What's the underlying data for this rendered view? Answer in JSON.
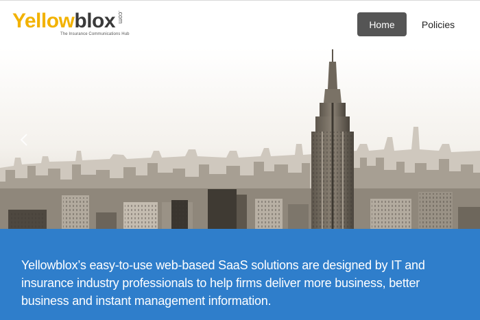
{
  "brand": {
    "logo_yellow": "Yellow",
    "logo_dark": "blox",
    "logo_com": ".com",
    "tagline": "The Insurance Communications Hub"
  },
  "nav": {
    "home_label": "Home",
    "policies_label": "Policies"
  },
  "hero": {
    "image": "city-skyline-photo",
    "prev_icon": "chevron-left-icon"
  },
  "banner": {
    "text": "Yellowblox’s easy-to-use web-based SaaS solutions are designed by IT and insurance industry professionals to help firms deliver more business, better business and instant management information."
  },
  "colors": {
    "brand_yellow": "#f2b200",
    "nav_active_bg": "#555555",
    "banner_bg": "#2f7ecb"
  }
}
